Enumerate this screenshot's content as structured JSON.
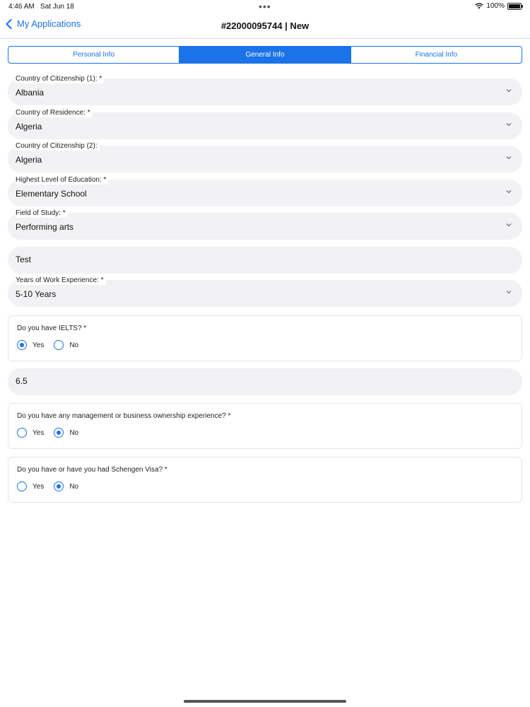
{
  "status": {
    "time": "4:46 AM",
    "date": "Sat Jun 18",
    "battery": "100%"
  },
  "nav": {
    "back_label": "My Applications",
    "title": "#22000095744 | New"
  },
  "tabs": [
    {
      "label": "Personal Info",
      "active": false
    },
    {
      "label": "General Info",
      "active": true
    },
    {
      "label": "Financial Info",
      "active": false
    }
  ],
  "fields": {
    "citizenship1": {
      "label": "Country of Citizenship (1): *",
      "value": "Albania"
    },
    "residence": {
      "label": "Country of Residence: *",
      "value": "Algeria"
    },
    "citizenship2": {
      "label": "Country of Citizenship (2):",
      "value": "Algeria"
    },
    "education": {
      "label": "Highest Level of Education: *",
      "value": "Elementary School"
    },
    "field_of_study": {
      "label": "Field of Study: *",
      "value": "Performing arts"
    },
    "other_field": {
      "value": "Test"
    },
    "work_experience": {
      "label": "Years of Work Experience: *",
      "value": "5-10 Years"
    },
    "ielts_score": {
      "value": "6.5"
    }
  },
  "questions": {
    "ielts": {
      "question": "Do you have IELTS? *",
      "yes": "Yes",
      "no": "No",
      "selected": "yes"
    },
    "management": {
      "question": "Do you have any management or business ownership experience? *",
      "yes": "Yes",
      "no": "No",
      "selected": "no"
    },
    "schengen": {
      "question": "Do you have or have you had Schengen Visa? *",
      "yes": "Yes",
      "no": "No",
      "selected": "no"
    }
  },
  "icons": {
    "back": "chevron-left-icon",
    "caret": "chevron-down-icon",
    "wifi": "wifi-icon",
    "battery": "battery-icon"
  },
  "colors": {
    "accent": "#1a73e8",
    "field_bg": "#f2f2f4"
  }
}
